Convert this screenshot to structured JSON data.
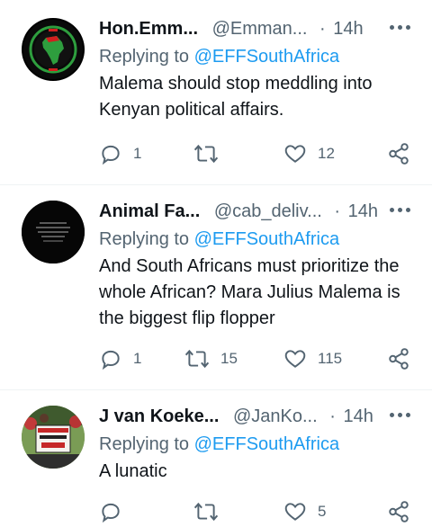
{
  "tweets": [
    {
      "name": "Hon.Emm...",
      "handle": "@Emman...",
      "sep": "·",
      "time": "14h",
      "replying_prefix": "Replying to ",
      "replying_to": "@EFFSouthAfrica",
      "text": "Malema should stop meddling into Kenyan political affairs.",
      "replies": "1",
      "retweets": "",
      "likes": "12"
    },
    {
      "name": "Animal Fa...",
      "handle": "@cab_deliv...",
      "sep": "·",
      "time": "14h",
      "replying_prefix": "Replying to ",
      "replying_to": "@EFFSouthAfrica",
      "text": "And South Africans must prioritize the whole African? Mara Julius Malema is the biggest flip flopper",
      "replies": "1",
      "retweets": "15",
      "likes": "115"
    },
    {
      "name": "J van Koeke...",
      "handle": "@JanKo...",
      "sep": "·",
      "time": "14h",
      "replying_prefix": "Replying to ",
      "replying_to": "@EFFSouthAfrica",
      "text": "A lunatic",
      "replies": "",
      "retweets": "",
      "likes": "5",
      "avatar_sign": "SOUTH AFRICAN CITIZENS FIRST"
    }
  ],
  "icons": [
    "reply-icon",
    "retweet-icon",
    "like-icon",
    "share-icon",
    "more-icon"
  ],
  "colors": {
    "text": "#0f1419",
    "secondary": "#536471",
    "link": "#1d9bf0",
    "divider": "#eff3f4"
  }
}
